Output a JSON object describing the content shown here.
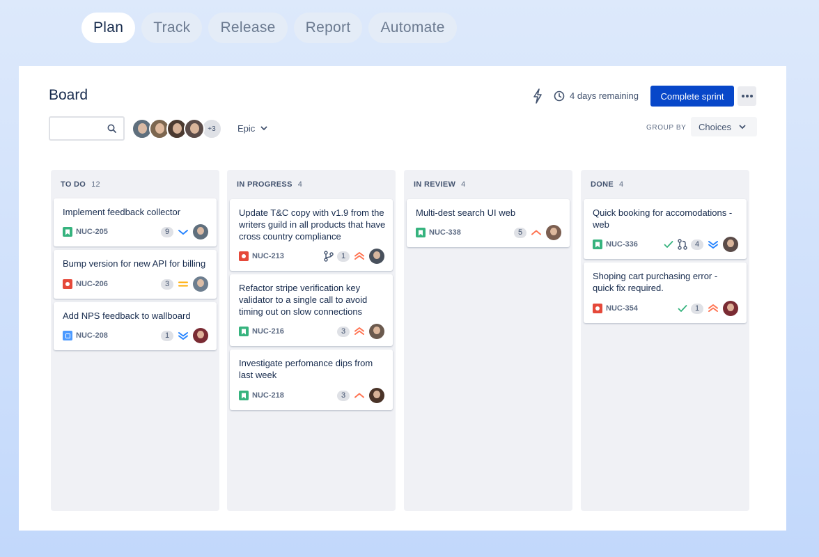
{
  "tabs": [
    {
      "label": "Plan",
      "active": true
    },
    {
      "label": "Track",
      "active": false
    },
    {
      "label": "Release",
      "active": false
    },
    {
      "label": "Report",
      "active": false
    },
    {
      "label": "Automate",
      "active": false
    }
  ],
  "board": {
    "title": "Board",
    "remaining": "4 days remaining",
    "complete_label": "Complete sprint",
    "more_icon": "more-dots-icon",
    "search_placeholder": "",
    "avatars_more": "+3",
    "epic_label": "Epic",
    "group_by_label": "GROUP BY",
    "group_by_value": "Choices"
  },
  "colors": {
    "accent": "#0747c9",
    "story": "#36b37e",
    "bug": "#e5493a",
    "task": "#4c9aff",
    "prio_high": "#ff7452",
    "prio_low": "#2684ff",
    "prio_medium": "#ffab00",
    "done_check": "#36b37e"
  },
  "columns": [
    {
      "title": "TO DO",
      "count": "12",
      "cards": [
        {
          "title": "Implement feedback collector",
          "key": "NUC-205",
          "type": "story",
          "count": "9",
          "priority": "low"
        },
        {
          "title": "Bump version for new API for billing",
          "key": "NUC-206",
          "type": "bug",
          "count": "3",
          "priority": "medium"
        },
        {
          "title": "Add NPS feedback to wallboard",
          "key": "NUC-208",
          "type": "task",
          "count": "1",
          "priority": "lowest"
        }
      ]
    },
    {
      "title": "IN PROGRESS",
      "count": "4",
      "cards": [
        {
          "title": "Update T&C copy with v1.9 from the writers guild in all products that have cross country compliance",
          "key": "NUC-213",
          "type": "bug",
          "count": "1",
          "priority": "highest",
          "branch": true
        },
        {
          "title": "Refactor stripe verification key validator to a single call to avoid timing out on slow connections",
          "key": "NUC-216",
          "type": "story",
          "count": "3",
          "priority": "highest"
        },
        {
          "title": "Investigate perfomance dips from last week",
          "key": "NUC-218",
          "type": "story",
          "count": "3",
          "priority": "high"
        }
      ]
    },
    {
      "title": "IN REVIEW",
      "count": "4",
      "cards": [
        {
          "title": "Multi-dest search UI web",
          "key": "NUC-338",
          "type": "story",
          "count": "5",
          "priority": "high"
        }
      ]
    },
    {
      "title": "DONE",
      "count": "4",
      "cards": [
        {
          "title": "Quick booking for accomodations - web",
          "key": "NUC-336",
          "type": "story",
          "count": "4",
          "priority": "lowest",
          "done": true,
          "pr": true
        },
        {
          "title": "Shoping cart purchasing error - quick fix required.",
          "key": "NUC-354",
          "type": "bug",
          "count": "1",
          "priority": "highest",
          "done": true
        }
      ]
    }
  ]
}
